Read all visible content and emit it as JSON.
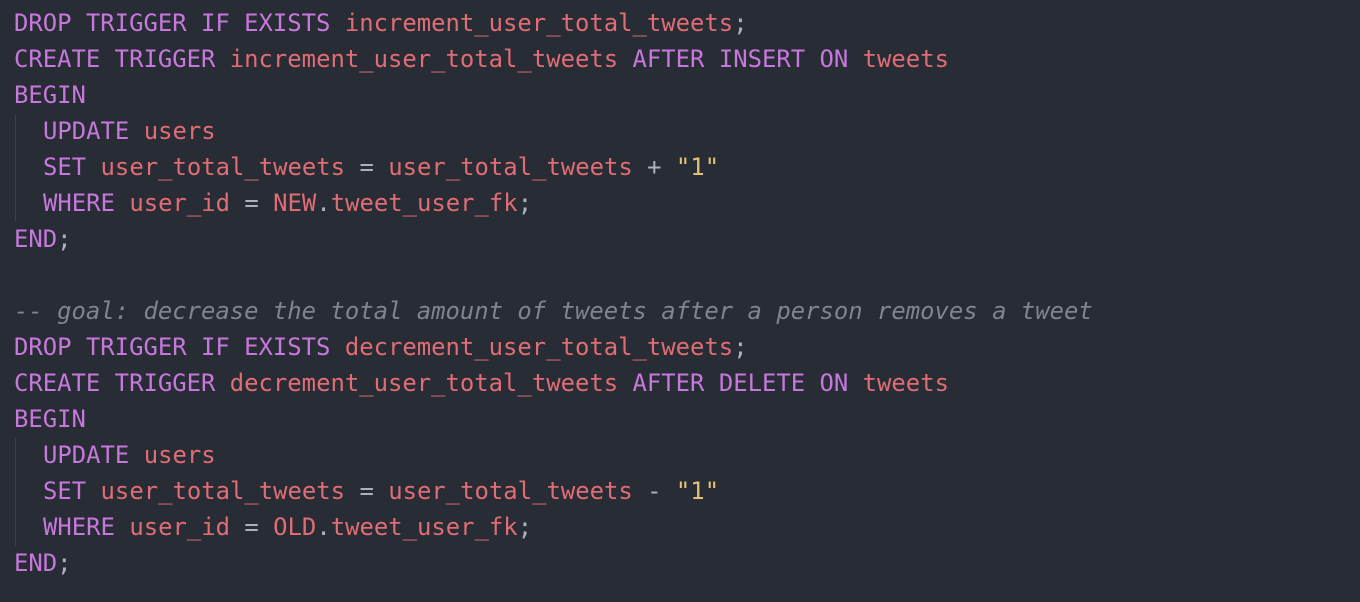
{
  "colors": {
    "background": "#282c34",
    "keyword": "#c678dd",
    "identifier": "#e06c75",
    "punctuation": "#abb2bf",
    "string": "#e5c07b",
    "comment": "#7f848e",
    "indent_guide": "#3b4048"
  },
  "lines": [
    [
      {
        "text": "DROP TRIGGER IF EXISTS ",
        "token": "keyword"
      },
      {
        "text": "increment_user_total_tweets",
        "token": "identifier"
      },
      {
        "text": ";",
        "token": "punctuation"
      }
    ],
    [
      {
        "text": "CREATE TRIGGER ",
        "token": "keyword"
      },
      {
        "text": "increment_user_total_tweets ",
        "token": "identifier"
      },
      {
        "text": "AFTER INSERT ON ",
        "token": "keyword"
      },
      {
        "text": "tweets",
        "token": "identifier"
      }
    ],
    [
      {
        "text": "BEGIN",
        "token": "keyword"
      }
    ],
    [
      {
        "text": "UPDATE ",
        "token": "keyword"
      },
      {
        "text": "users",
        "token": "identifier"
      }
    ],
    [
      {
        "text": "SET ",
        "token": "keyword"
      },
      {
        "text": "user_total_tweets",
        "token": "identifier"
      },
      {
        "text": " = ",
        "token": "punctuation"
      },
      {
        "text": "user_total_tweets",
        "token": "identifier"
      },
      {
        "text": " + ",
        "token": "punctuation"
      },
      {
        "text": "\"1\"",
        "token": "string"
      }
    ],
    [
      {
        "text": "WHERE ",
        "token": "keyword"
      },
      {
        "text": "user_id",
        "token": "identifier"
      },
      {
        "text": " = ",
        "token": "punctuation"
      },
      {
        "text": "NEW",
        "token": "identifier"
      },
      {
        "text": ".",
        "token": "punctuation"
      },
      {
        "text": "tweet_user_fk",
        "token": "identifier"
      },
      {
        "text": ";",
        "token": "punctuation"
      }
    ],
    [
      {
        "text": "END",
        "token": "keyword"
      },
      {
        "text": ";",
        "token": "punctuation"
      }
    ],
    [],
    [
      {
        "text": "-- goal: decrease the total amount of tweets after a person removes a tweet",
        "token": "comment"
      }
    ],
    [
      {
        "text": "DROP TRIGGER IF EXISTS ",
        "token": "keyword"
      },
      {
        "text": "decrement_user_total_tweets",
        "token": "identifier"
      },
      {
        "text": ";",
        "token": "punctuation"
      }
    ],
    [
      {
        "text": "CREATE TRIGGER ",
        "token": "keyword"
      },
      {
        "text": "decrement_user_total_tweets ",
        "token": "identifier"
      },
      {
        "text": "AFTER DELETE ON ",
        "token": "keyword"
      },
      {
        "text": "tweets",
        "token": "identifier"
      }
    ],
    [
      {
        "text": "BEGIN",
        "token": "keyword"
      }
    ],
    [
      {
        "text": "UPDATE ",
        "token": "keyword"
      },
      {
        "text": "users",
        "token": "identifier"
      }
    ],
    [
      {
        "text": "SET ",
        "token": "keyword"
      },
      {
        "text": "user_total_tweets",
        "token": "identifier"
      },
      {
        "text": " = ",
        "token": "punctuation"
      },
      {
        "text": "user_total_tweets",
        "token": "identifier"
      },
      {
        "text": " - ",
        "token": "punctuation"
      },
      {
        "text": "\"1\"",
        "token": "string"
      }
    ],
    [
      {
        "text": "WHERE ",
        "token": "keyword"
      },
      {
        "text": "user_id",
        "token": "identifier"
      },
      {
        "text": " = ",
        "token": "punctuation"
      },
      {
        "text": "OLD",
        "token": "identifier"
      },
      {
        "text": ".",
        "token": "punctuation"
      },
      {
        "text": "tweet_user_fk",
        "token": "identifier"
      },
      {
        "text": ";",
        "token": "punctuation"
      }
    ],
    [
      {
        "text": "END",
        "token": "keyword"
      },
      {
        "text": ";",
        "token": "punctuation"
      }
    ]
  ]
}
